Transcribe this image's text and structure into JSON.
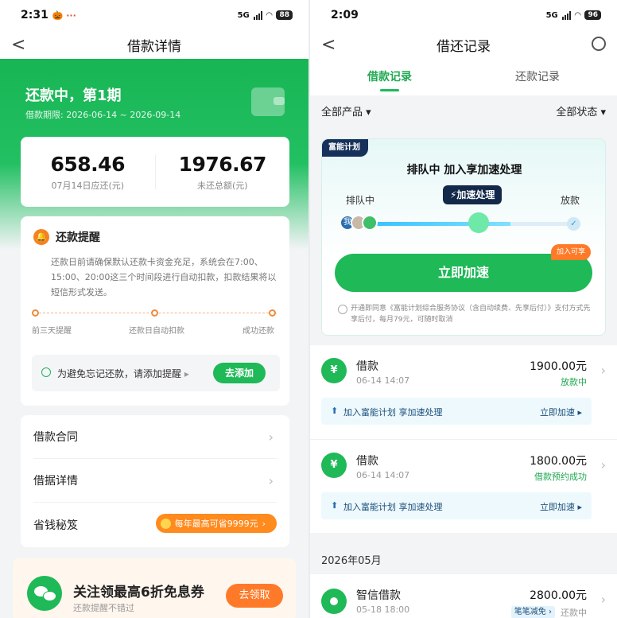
{
  "left": {
    "status": {
      "time": "2:31",
      "icons": "🎃 ···",
      "battery": "88",
      "signal": "5G"
    },
    "nav": {
      "back": "<",
      "title": "借款详情"
    },
    "hero": {
      "title": "还款中，第1期",
      "period": "借款期限: 2026-06-14 ~ 2026-09-14"
    },
    "amounts": [
      {
        "value": "658.46",
        "label": "07月14日应还(元)"
      },
      {
        "value": "1976.67",
        "label": "未还总额(元)"
      }
    ],
    "reminder": {
      "title": "还款提醒",
      "body": "还款日前请确保默认还款卡资金充足，系统会在7:00、15:00、20:00这三个时间段进行自动扣款，扣款结果将以短信形式发送。",
      "steps": [
        "前三天提醒",
        "还款日自动扣款",
        "成功还款"
      ],
      "tip": "为避免忘记还款，请添加提醒",
      "tip_arrow": "▸",
      "add_button": "去添加"
    },
    "menu": [
      {
        "label": "借款合同"
      },
      {
        "label": "借据详情"
      },
      {
        "label": "省钱秘笈",
        "pill": "每年最高可省9999元",
        "pill_arrow": "›"
      }
    ],
    "promo": {
      "title": "关注领最高6折免息券",
      "subtitle": "还款提醒不错过",
      "button": "去领取"
    }
  },
  "right": {
    "status": {
      "time": "2:09",
      "battery": "96",
      "signal": "5G"
    },
    "nav": {
      "back": "<",
      "title": "借还记录"
    },
    "tabs": [
      {
        "label": "借款记录",
        "active": true
      },
      {
        "label": "还款记录",
        "active": false
      }
    ],
    "filters": {
      "product": "全部产品 ▾",
      "status": "全部状态 ▾"
    },
    "fast": {
      "badge": "富能计划",
      "title": "排队中  加入享加速处理",
      "queue_label": "排队中",
      "speed_label": "⚡加速处理",
      "payout_label": "放款",
      "me": "我",
      "check": "✓",
      "button": "立即加速",
      "button_tag": "加入可享",
      "agreement": "开通即同意《富能计划综合服务协议（含自动续费、先享后付）》支付方式先享后付，每月79元，可随时取消"
    },
    "loans": [
      {
        "name": "借款",
        "date": "06-14 14:07",
        "amount": "1900.00元",
        "status": "放款中",
        "sub": "加入富能计划 享加速处理",
        "sub_action": "立即加速 ▸"
      },
      {
        "name": "借款",
        "date": "06-14 14:07",
        "amount": "1800.00元",
        "status": "借款预约成功",
        "sub": "加入富能计划 享加速处理",
        "sub_action": "立即加速 ▸"
      }
    ],
    "month": "2026年05月",
    "last": {
      "name": "智信借款",
      "date": "05-18 18:00",
      "amount": "2800.00元",
      "tag": "笔笔减免 ›",
      "status": "还款中"
    }
  },
  "colors": {
    "brand_green": "#1fb957",
    "orange": "#ff7a28",
    "navy": "#13294a"
  }
}
